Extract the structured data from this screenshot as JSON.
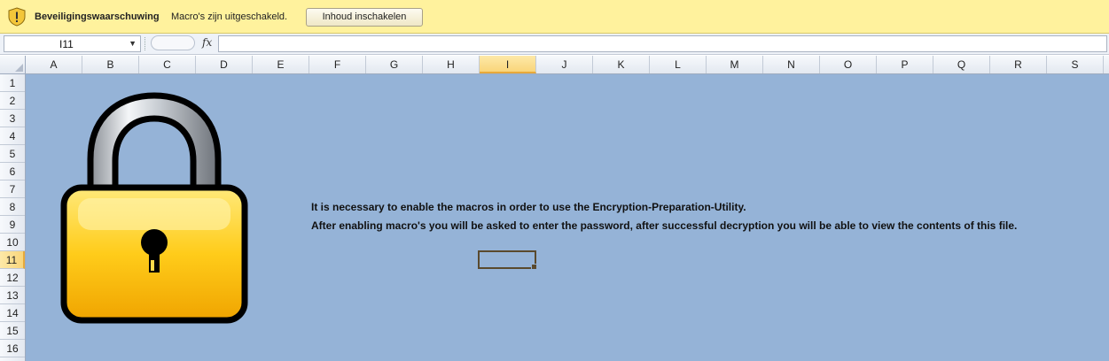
{
  "security_bar": {
    "title": "Beveiligingswaarschuwing",
    "message": "Macro's zijn uitgeschakeld.",
    "button_label": "Inhoud inschakelen",
    "icon": "shield-warning-icon",
    "background_color": "#fff29d"
  },
  "formula_bar": {
    "name_box_value": "I11",
    "fx_label": "fx",
    "formula_value": ""
  },
  "columns": [
    "A",
    "B",
    "C",
    "D",
    "E",
    "F",
    "G",
    "H",
    "I",
    "J",
    "K",
    "L",
    "M",
    "N",
    "O",
    "P",
    "Q",
    "R",
    "S"
  ],
  "rows": [
    "1",
    "2",
    "3",
    "4",
    "5",
    "6",
    "7",
    "8",
    "9",
    "10",
    "11",
    "12",
    "13",
    "14",
    "15",
    "16"
  ],
  "selected_column": "I",
  "selected_row": "11",
  "sheet": {
    "background_color": "#95b3d7",
    "image": "padlock-icon",
    "message_line_1": "It is necessary to enable the macros in order to use the Encryption-Preparation-Utility.",
    "message_line_2": "After enabling macro's you will be asked to enter the password, after successful decryption you will be able to view the contents of this file."
  }
}
